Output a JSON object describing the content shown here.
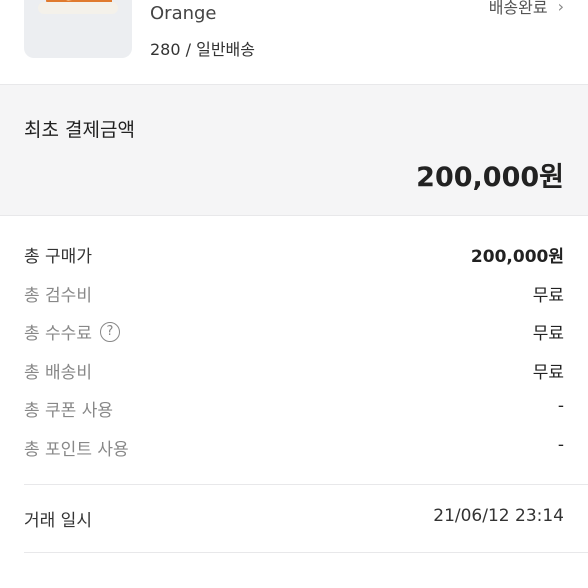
{
  "product": {
    "name": "Orange",
    "option": "280 / 일반배송",
    "status": "배송완료",
    "status_icon": "chevron-right-icon"
  },
  "payment": {
    "total_label": "최초 결제금액",
    "total_amount": "200,000원"
  },
  "details": [
    {
      "label": "총 구매가",
      "value": "200,000원"
    },
    {
      "label": "총 검수비",
      "value": "무료"
    },
    {
      "label": "총 수수료",
      "value": "무료",
      "icon": "help-icon"
    },
    {
      "label": "총 배송비",
      "value": "무료"
    },
    {
      "label": "총 쿠폰 사용",
      "value": "-"
    },
    {
      "label": "총 포인트 사용",
      "value": "-"
    }
  ],
  "trade": {
    "label": "거래 일시",
    "value": "21/06/12 23:14"
  },
  "colors": {
    "product_accent": "#e07a2e",
    "panel_bg": "#f5f5f6",
    "muted_text": "#888888"
  }
}
